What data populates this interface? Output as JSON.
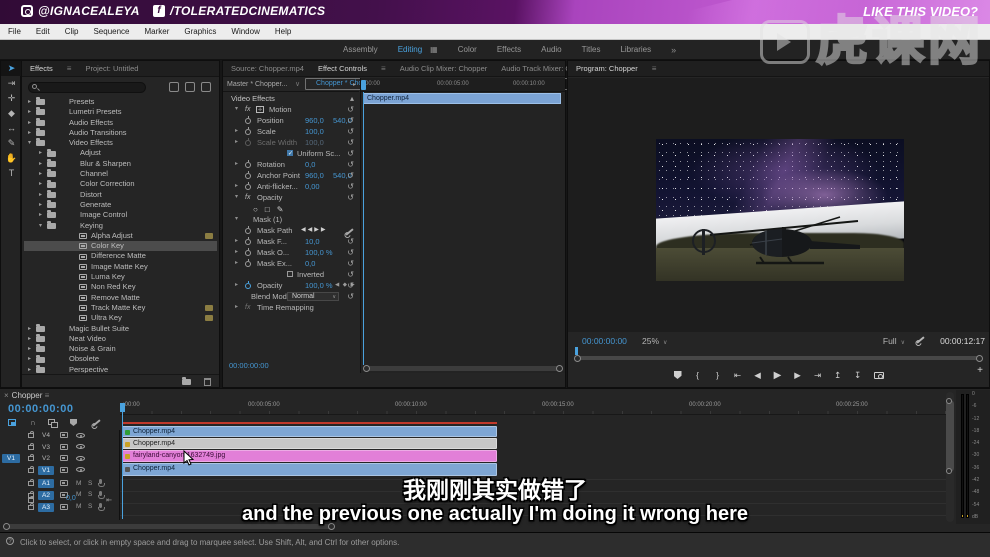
{
  "banner": {
    "instagram_handle": "@IGNACEALEYA",
    "facebook_handle": "/TOLERATEDCINEMATICS",
    "facebook_f": "f",
    "cta": "LIKE THIS VIDEO?"
  },
  "watermark": {
    "text": "虎课网"
  },
  "menu": {
    "items": [
      "File",
      "Edit",
      "Clip",
      "Sequence",
      "Marker",
      "Graphics",
      "Window",
      "Help"
    ]
  },
  "workspace": {
    "tabs": [
      {
        "label": "Assembly",
        "active": false
      },
      {
        "label": "Editing",
        "active": true
      },
      {
        "label": "Color",
        "active": false
      },
      {
        "label": "Effects",
        "active": false
      },
      {
        "label": "Audio",
        "active": false
      },
      {
        "label": "Titles",
        "active": false
      },
      {
        "label": "Libraries",
        "active": false
      }
    ],
    "overflow": "»"
  },
  "icons": {
    "panel_menu": "≡",
    "overflow": "»",
    "close": "×",
    "dropdown": "∨",
    "arrow_right": "▸",
    "grid": "▦",
    "snap": "∩",
    "reset": "↺",
    "check": "✓",
    "play": "▶",
    "step_back": "◀",
    "step_fwd": "▶",
    "go_in": "⇤",
    "go_out": "⇥",
    "mark_in": "{",
    "mark_out": "}",
    "lift": "↥",
    "extract": "↧",
    "plus": "+",
    "kf_nav": "◀◀▶▶",
    "kf_cluster": "◀ ◆ ▶",
    "ellipse_tool": "○",
    "rect_tool": "□",
    "pen_tool": "✎",
    "motion": "✛",
    "fit_handle": "⇤",
    "help": "?",
    "tools": [
      "➤",
      "⇥",
      "✛",
      "◆",
      "↔",
      "✎",
      "✋",
      "T"
    ]
  },
  "effects_panel": {
    "tab_effects": "Effects",
    "tab_project": "Project: Untitled",
    "tree": [
      {
        "label": "Presets",
        "depth": 0,
        "folder": true,
        "chev": true
      },
      {
        "label": "Lumetri Presets",
        "depth": 0,
        "folder": true,
        "chev": true
      },
      {
        "label": "Audio Effects",
        "depth": 0,
        "folder": true,
        "chev": true
      },
      {
        "label": "Audio Transitions",
        "depth": 0,
        "folder": true,
        "chev": true
      },
      {
        "label": "Video Effects",
        "depth": 0,
        "folder": true,
        "chev": true,
        "open": true
      },
      {
        "label": "Adjust",
        "depth": 1,
        "folder": true,
        "chev": true
      },
      {
        "label": "Blur & Sharpen",
        "depth": 1,
        "folder": true,
        "chev": true
      },
      {
        "label": "Channel",
        "depth": 1,
        "folder": true,
        "chev": true
      },
      {
        "label": "Color Correction",
        "depth": 1,
        "folder": true,
        "chev": true
      },
      {
        "label": "Distort",
        "depth": 1,
        "folder": true,
        "chev": true
      },
      {
        "label": "Generate",
        "depth": 1,
        "folder": true,
        "chev": true
      },
      {
        "label": "Image Control",
        "depth": 1,
        "folder": true,
        "chev": true
      },
      {
        "label": "Keying",
        "depth": 1,
        "folder": true,
        "chev": true,
        "open": true
      },
      {
        "label": "Alpha Adjust",
        "depth": 2,
        "effect": true,
        "badge": true
      },
      {
        "label": "Color Key",
        "depth": 2,
        "effect": true,
        "selected": true
      },
      {
        "label": "Difference Matte",
        "depth": 2,
        "effect": true
      },
      {
        "label": "Image Matte Key",
        "depth": 2,
        "effect": true
      },
      {
        "label": "Luma Key",
        "depth": 2,
        "effect": true
      },
      {
        "label": "Non Red Key",
        "depth": 2,
        "effect": true
      },
      {
        "label": "Remove Matte",
        "depth": 2,
        "effect": true
      },
      {
        "label": "Track Matte Key",
        "depth": 2,
        "effect": true,
        "badge": true
      },
      {
        "label": "Ultra Key",
        "depth": 2,
        "effect": true,
        "badge": true
      },
      {
        "label": "Magic Bullet Suite",
        "depth": 0,
        "folder": true,
        "chev": true
      },
      {
        "label": "Neat Video",
        "depth": 0,
        "folder": true,
        "chev": true
      },
      {
        "label": "Noise & Grain",
        "depth": 0,
        "folder": true,
        "chev": true
      },
      {
        "label": "Obsolete",
        "depth": 0,
        "folder": true,
        "chev": true
      },
      {
        "label": "Perspective",
        "depth": 0,
        "folder": true,
        "chev": true
      }
    ]
  },
  "ec": {
    "tab_source": "Source: Chopper.mp4",
    "tab_ec": "Effect Controls",
    "tab_acm": "Audio Clip Mixer: Chopper",
    "tab_atm": "Audio Track Mixer: Chopper",
    "master_label": "Master * Chopper...",
    "clip_label": "Chopper * Cho...",
    "section": "Video Effects",
    "rows": [
      {
        "label": "Motion"
      },
      {
        "label": "Position",
        "v1": "960,0",
        "v2": "540,0"
      },
      {
        "label": "Scale",
        "v1": "100,0"
      },
      {
        "label": "Scale Width",
        "v1": "100,0"
      },
      {
        "label": "Uniform Sc..."
      },
      {
        "label": "Rotation",
        "v1": "0,0"
      },
      {
        "label": "Anchor Point",
        "v1": "960,0",
        "v2": "540,0"
      },
      {
        "label": "Anti-flicker...",
        "v1": "0,00"
      },
      {
        "label": "Opacity"
      },
      {
        "label": ""
      },
      {
        "label": "Mask (1)"
      },
      {
        "label": "Mask Path"
      },
      {
        "label": "Mask F...",
        "v1": "10,0"
      },
      {
        "label": "Mask O...",
        "v1": "100,0 %"
      },
      {
        "label": "Mask Ex...",
        "v1": "0,0"
      },
      {
        "label": "Inverted"
      },
      {
        "label": "Opacity",
        "v1": "100,0 %"
      },
      {
        "label": "Blend Mode",
        "value": "Normal"
      },
      {
        "label": "Time Remapping"
      }
    ],
    "mini_ruler": [
      "00:00",
      "00:00:05:00",
      "00:00:10:00"
    ],
    "mini_clip": "Chopper.mp4",
    "bottom_timecode": "00:00:00:00"
  },
  "program": {
    "tab": "Program: Chopper",
    "timecode": "00:00:00:00",
    "zoom_level": "25%",
    "scale_select": "Full",
    "duration": "00:00:12:17"
  },
  "timeline": {
    "tab": "Chopper",
    "timecode": "00:00:00:00",
    "ruler": [
      ":00:00",
      "00:00:05:00",
      "00:00:10:00",
      "00:00:15:00",
      "00:00:20:00",
      "00:00:25:00"
    ],
    "video_tracks": [
      {
        "name": "V4"
      },
      {
        "name": "V3"
      },
      {
        "name": "V2",
        "patch": "V1"
      },
      {
        "name": "V1",
        "targeted": true
      }
    ],
    "audio_tracks": [
      {
        "name": "A1"
      },
      {
        "name": "A2"
      },
      {
        "name": "A3"
      }
    ],
    "mute": "M",
    "solo": "S",
    "master_value": "0,0",
    "clips": [
      {
        "label": "Chopper.mp4"
      },
      {
        "label": "Chopper.mp4"
      },
      {
        "label": "fairyland-canyon-1632749.jpg"
      },
      {
        "label": "Chopper.mp4"
      }
    ]
  },
  "meters": {
    "ticks": [
      "0",
      "-6",
      "-12",
      "-18",
      "-24",
      "-30",
      "-36",
      "-42",
      "-48",
      "-54",
      "dB"
    ]
  },
  "status": {
    "text": "Click to select, or click in empty space and drag to marquee select. Use Shift, Alt, and Ctrl for other options."
  },
  "subtitles": {
    "line1": "我刚刚其实做错了",
    "line2": "and the previous one actually I'm doing it wrong here"
  }
}
